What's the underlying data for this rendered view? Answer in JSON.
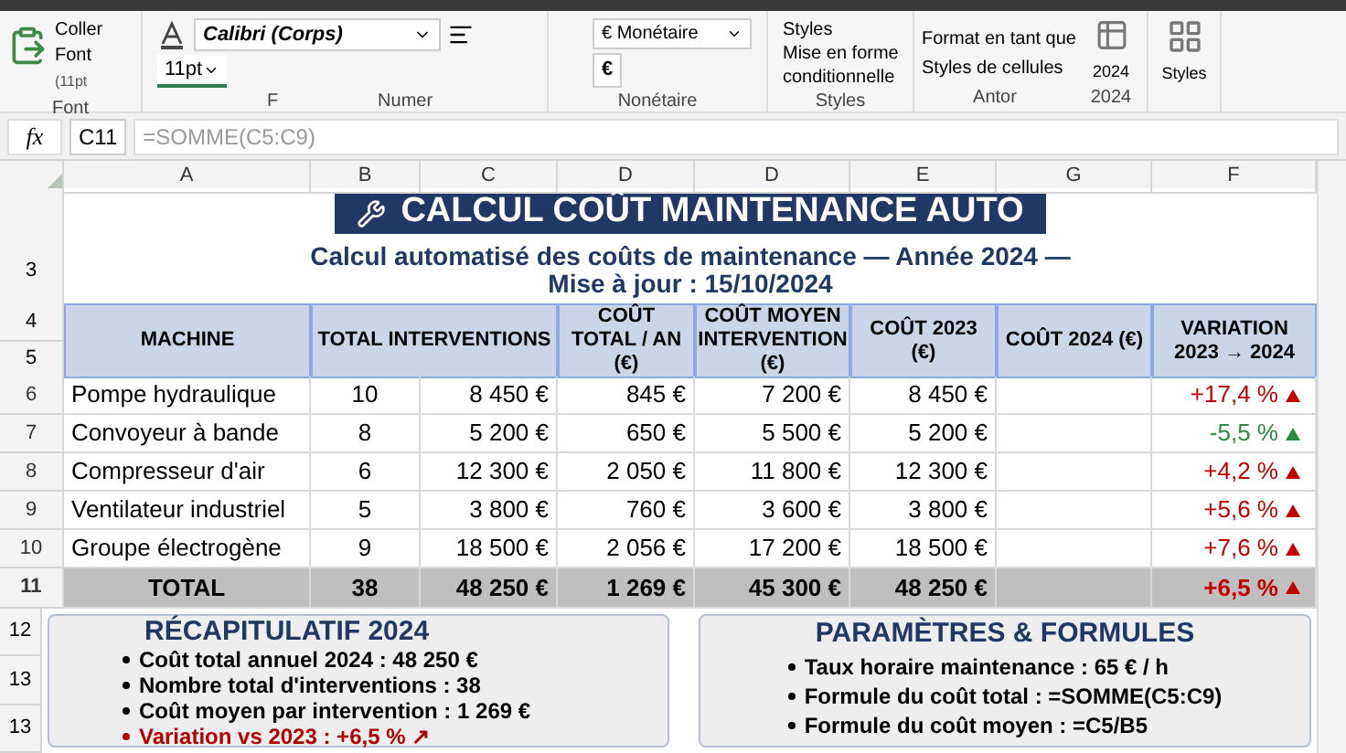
{
  "ribbon": {
    "clipboard": {
      "items": [
        "Coller",
        "Font",
        "(11pt"
      ],
      "label": "Font"
    },
    "font": {
      "name": "Calibri (Corps)",
      "size": "11pt",
      "label": "F"
    },
    "number_label": "Numer",
    "currency": {
      "format": "€ Monétaire",
      "symbol": "€",
      "label": "Nonétaire"
    },
    "styles": {
      "items": [
        "Styles",
        "Mise en forme",
        "conditionnelle"
      ],
      "label": "Styles"
    },
    "antor": {
      "items": [
        "Format en tant que",
        "Styles de cellules"
      ],
      "label": "Antor"
    },
    "year": {
      "button": "2024",
      "label": "2024"
    },
    "styles_button": "Styles"
  },
  "formula_bar": {
    "icon_text": "fx",
    "cell": "C11",
    "formula": "=SOMME(C5:C9)"
  },
  "column_headers": [
    "A",
    "B",
    "C",
    "D",
    "D",
    "E",
    "G",
    "F"
  ],
  "title": "CALCUL COÛT MAINTENANCE AUTO",
  "subtitle": {
    "row_number": "3",
    "lines": [
      "Calcul automatisé des coûts de maintenance — Année 2024 —",
      "Mise à jour : 15/10/2024"
    ]
  },
  "table": {
    "row_numbers": [
      "4",
      "5"
    ],
    "columns": [
      "MACHINE",
      "TOTAL INTERVENTIONS",
      "COÛT TOTAL / AN (€)",
      "COÛT MOYEN INTERVENTION (€)",
      "COÛT 2023 (€)",
      "COÛT 2024 (€)",
      "VARIATION 2023 → 2024"
    ],
    "rows": [
      {
        "row_number": "6",
        "machine": "Pompe hydraulique",
        "interventions": "10",
        "cost": "8 450 €",
        "cost_per_year": "845 €",
        "avg_cost": "7 200 €",
        "cost_2023": "8 450 €",
        "variation": "+17,4 %",
        "color": "#c00000"
      },
      {
        "row_number": "7",
        "machine": "Convoyeur à bande",
        "interventions": "8",
        "cost": "5 200 €",
        "cost_per_year": "650 €",
        "avg_cost": "5 500 €",
        "cost_2023": "5 200 €",
        "variation": "-5,5 %",
        "color": "#2e8b3e"
      },
      {
        "row_number": "8",
        "machine": "Compresseur d'air",
        "interventions": "6",
        "cost": "12 300 €",
        "cost_per_year": "2 050 €",
        "avg_cost": "11 800 €",
        "cost_2023": "12 300 €",
        "variation": "+4,2 %",
        "color": "#c00000"
      },
      {
        "row_number": "9",
        "machine": "Ventilateur industriel",
        "interventions": "5",
        "cost": "3 800 €",
        "cost_per_year": "760 €",
        "avg_cost": "3 600 €",
        "cost_2023": "3 800 €",
        "variation": "+5,6 %",
        "color": "#c00000"
      },
      {
        "row_number": "10",
        "machine": "Groupe électrogène",
        "interventions": "9",
        "cost": "18 500 €",
        "cost_per_year": "2 056 €",
        "avg_cost": "17 200 €",
        "cost_2023": "18 500 €",
        "variation": "+7,6 %",
        "color": "#c00000"
      }
    ],
    "total": {
      "row_number": "11",
      "machine": "TOTAL",
      "interventions": "38",
      "cost": "48 250 €",
      "cost_per_year": "1 269 €",
      "avg_cost": "45 300 €",
      "cost_2023": "48 250 €",
      "variation": "+6,5 %",
      "color": "#c00000"
    }
  },
  "bottom_row_numbers": [
    "12",
    "13",
    "13"
  ],
  "summary": {
    "title": "RÉCAPITULATIF 2024",
    "items": [
      {
        "text": "Coût total annuel 2024 : 48 250 €",
        "emphasis": false
      },
      {
        "text": "Nombre total d'interventions : 38",
        "emphasis": false
      },
      {
        "text": "Coût moyen par intervention : 1 269 €",
        "emphasis": false
      },
      {
        "text": "Variation vs 2023 : +6,5 % ↗",
        "emphasis": true
      }
    ]
  },
  "parameters": {
    "title": "PARAMÈTRES & FORMULES",
    "items": [
      "Taux horaire maintenance : 65 € / h",
      "Formule du coût total : =SOMME(C5:C9)",
      "Formule du coût moyen : =C5/B5"
    ]
  }
}
